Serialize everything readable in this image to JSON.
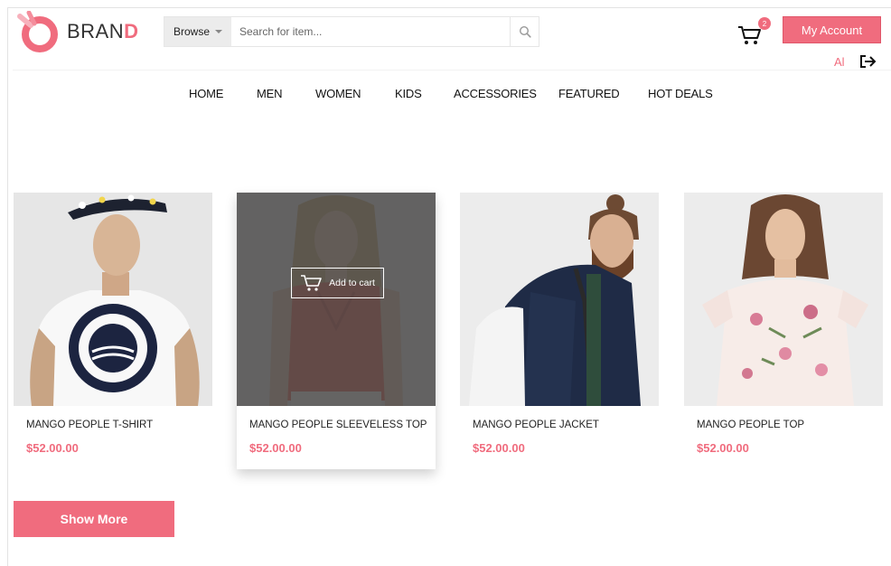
{
  "brand": {
    "name_main": "BRAN",
    "name_accent": "D",
    "accent": "#f06c7e"
  },
  "search": {
    "category_label": "Browse",
    "placeholder": "Search for item..."
  },
  "cart": {
    "count": "2"
  },
  "account": {
    "button_label": "My Account",
    "user_initials": "Al"
  },
  "nav": [
    "HOME",
    "MEN",
    "WOMEN",
    "KIDS",
    "ACCESSORIES",
    "FEATURED",
    "HOT DEALS"
  ],
  "products": [
    {
      "name": "MANGO PEOPLE T-SHIRT",
      "price": "$52.00.00"
    },
    {
      "name": "MANGO PEOPLE SLEEVELESS TOP",
      "price": "$52.00.00",
      "overlay_label": "Add to cart"
    },
    {
      "name": "MANGO PEOPLE JACKET",
      "price": "$52.00.00"
    },
    {
      "name": "MANGO PEOPLE TOP",
      "price": "$52.00.00"
    }
  ],
  "show_more_label": "Show More",
  "icons": [
    "brand-logo-icon",
    "caret-down-icon",
    "search-icon",
    "cart-icon",
    "logout-icon",
    "add-to-cart-icon"
  ]
}
